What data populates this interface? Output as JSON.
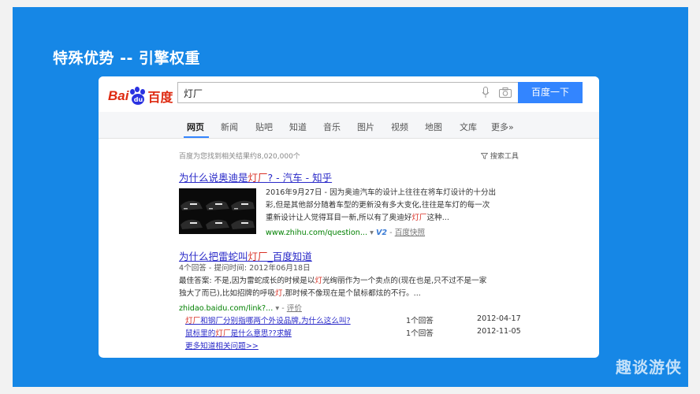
{
  "slide": {
    "title": "特殊优势 -- 引擎权重",
    "watermark": "趣谈游侠"
  },
  "colors": {
    "slide_bg": "#1687e6",
    "accent": "#3385ff",
    "link": "#2a2ac8",
    "highlight": "#d93025",
    "url_green": "#008000"
  },
  "logo": {
    "bai": "Bai",
    "paw": "du",
    "du": "百度"
  },
  "search": {
    "query": "灯厂",
    "button": "百度一下",
    "mic_icon": "mic-icon",
    "camera_icon": "camera-icon"
  },
  "nav": {
    "items": [
      "网页",
      "新闻",
      "贴吧",
      "知道",
      "音乐",
      "图片",
      "视频",
      "地图",
      "文库",
      "更多»"
    ],
    "active": "网页"
  },
  "stats": "百度为您找到相关结果约8,020,000个",
  "tools": "搜索工具",
  "result1": {
    "title_pre": "为什么说奥迪是",
    "title_hl": "灯厂",
    "title_post": "? - 汽车 - 知乎",
    "line1": "2016年9月27日 - 因为奥迪汽车的设计上往往在将车灯设计的十分出",
    "line2": "彩,但是其他部分随着车型的更新没有多大变化,往往是车灯的每一次",
    "line3_pre": "重新设计让人觉得耳目一新,所以有了奥迪好",
    "line3_hl": "灯厂",
    "line3_post": "这种...",
    "url": "www.zhihu.com/question...",
    "v_badge": "V2",
    "cache": "百度快照"
  },
  "result2": {
    "title_pre": "为什么把雷蛇叫",
    "title_hl": "灯厂",
    "title_post": "_百度知道",
    "meta": "4个回答 - 提问时间: 2012年06月18日",
    "ans1_pre": "最佳答案: 不是,因为雷蛇成长的时候是以",
    "ans1_hl": "灯",
    "ans1_post": "光绚丽作为一个卖点的(现在也是,只不过不是一家",
    "ans2_pre": "独大了而已),比如招牌的呼吸",
    "ans2_hl": "灯",
    "ans2_post": ",那时候不像现在是个鼠标都炫的不行。...",
    "url": "zhidao.baidu.com/link?...",
    "rate": "评价",
    "related": [
      {
        "hl": "灯厂",
        "rest": "和钢厂分别指哪两个外设品牌,为什么这么叫?",
        "count": "1个回答",
        "date": "2012-04-17"
      },
      {
        "pre": "鼠标里的",
        "hl": "灯厂",
        "rest": "是什么意思??求解",
        "count": "1个回答",
        "date": "2012-11-05"
      }
    ],
    "more": "更多知道相关问题>>"
  }
}
